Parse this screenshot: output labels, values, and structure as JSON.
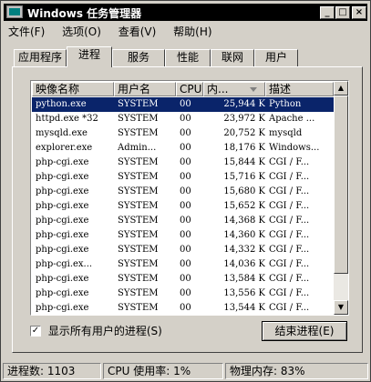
{
  "window": {
    "title": "Windows 任务管理器"
  },
  "title_buttons": {
    "minimize": "_",
    "maximize": "□",
    "close": "×"
  },
  "menu": [
    "文件(F)",
    "选项(O)",
    "查看(V)",
    "帮助(H)"
  ],
  "tabs": [
    {
      "label": "应用程序",
      "active": false
    },
    {
      "label": "进程",
      "active": true
    },
    {
      "label": "服务",
      "active": false
    },
    {
      "label": "性能",
      "active": false
    },
    {
      "label": "联网",
      "active": false
    },
    {
      "label": "用户",
      "active": false
    }
  ],
  "columns": {
    "name": "映像名称",
    "user": "用户名",
    "cpu": "CPU",
    "mem": "内...",
    "mem_sort_icon": "triangle-down-icon",
    "desc": "描述"
  },
  "processes": [
    {
      "name": "python.exe",
      "user": "SYSTEM",
      "cpu": "00",
      "mem": "25,944 K",
      "desc": "Python",
      "selected": true
    },
    {
      "name": "httpd.exe *32",
      "user": "SYSTEM",
      "cpu": "00",
      "mem": "23,972 K",
      "desc": "Apache ..."
    },
    {
      "name": "mysqld.exe",
      "user": "SYSTEM",
      "cpu": "00",
      "mem": "20,752 K",
      "desc": "mysqld"
    },
    {
      "name": "explorer.exe",
      "user": "Admin...",
      "cpu": "00",
      "mem": "18,176 K",
      "desc": "Windows..."
    },
    {
      "name": "php-cgi.exe",
      "user": "SYSTEM",
      "cpu": "00",
      "mem": "15,844 K",
      "desc": "CGI / F..."
    },
    {
      "name": "php-cgi.exe",
      "user": "SYSTEM",
      "cpu": "00",
      "mem": "15,716 K",
      "desc": "CGI / F..."
    },
    {
      "name": "php-cgi.exe",
      "user": "SYSTEM",
      "cpu": "00",
      "mem": "15,680 K",
      "desc": "CGI / F..."
    },
    {
      "name": "php-cgi.exe",
      "user": "SYSTEM",
      "cpu": "00",
      "mem": "15,652 K",
      "desc": "CGI / F..."
    },
    {
      "name": "php-cgi.exe",
      "user": "SYSTEM",
      "cpu": "00",
      "mem": "14,368 K",
      "desc": "CGI / F..."
    },
    {
      "name": "php-cgi.exe",
      "user": "SYSTEM",
      "cpu": "00",
      "mem": "14,360 K",
      "desc": "CGI / F..."
    },
    {
      "name": "php-cgi.exe",
      "user": "SYSTEM",
      "cpu": "00",
      "mem": "14,332 K",
      "desc": "CGI / F..."
    },
    {
      "name": "php-cgi.ex...",
      "user": "SYSTEM",
      "cpu": "00",
      "mem": "14,036 K",
      "desc": "CGI / F..."
    },
    {
      "name": "php-cgi.exe",
      "user": "SYSTEM",
      "cpu": "00",
      "mem": "13,584 K",
      "desc": "CGI / F..."
    },
    {
      "name": "php-cgi.exe",
      "user": "SYSTEM",
      "cpu": "00",
      "mem": "13,556 K",
      "desc": "CGI / F..."
    },
    {
      "name": "php-cgi.exe",
      "user": "SYSTEM",
      "cpu": "00",
      "mem": "13,544 K",
      "desc": "CGI / F..."
    }
  ],
  "show_all_users": {
    "label": "显示所有用户的进程(S)",
    "checked": true
  },
  "end_process_button": "结束进程(E)",
  "status": {
    "processes": "进程数: 1103",
    "cpu": "CPU 使用率: 1%",
    "memory": "物理内存: 83%"
  }
}
